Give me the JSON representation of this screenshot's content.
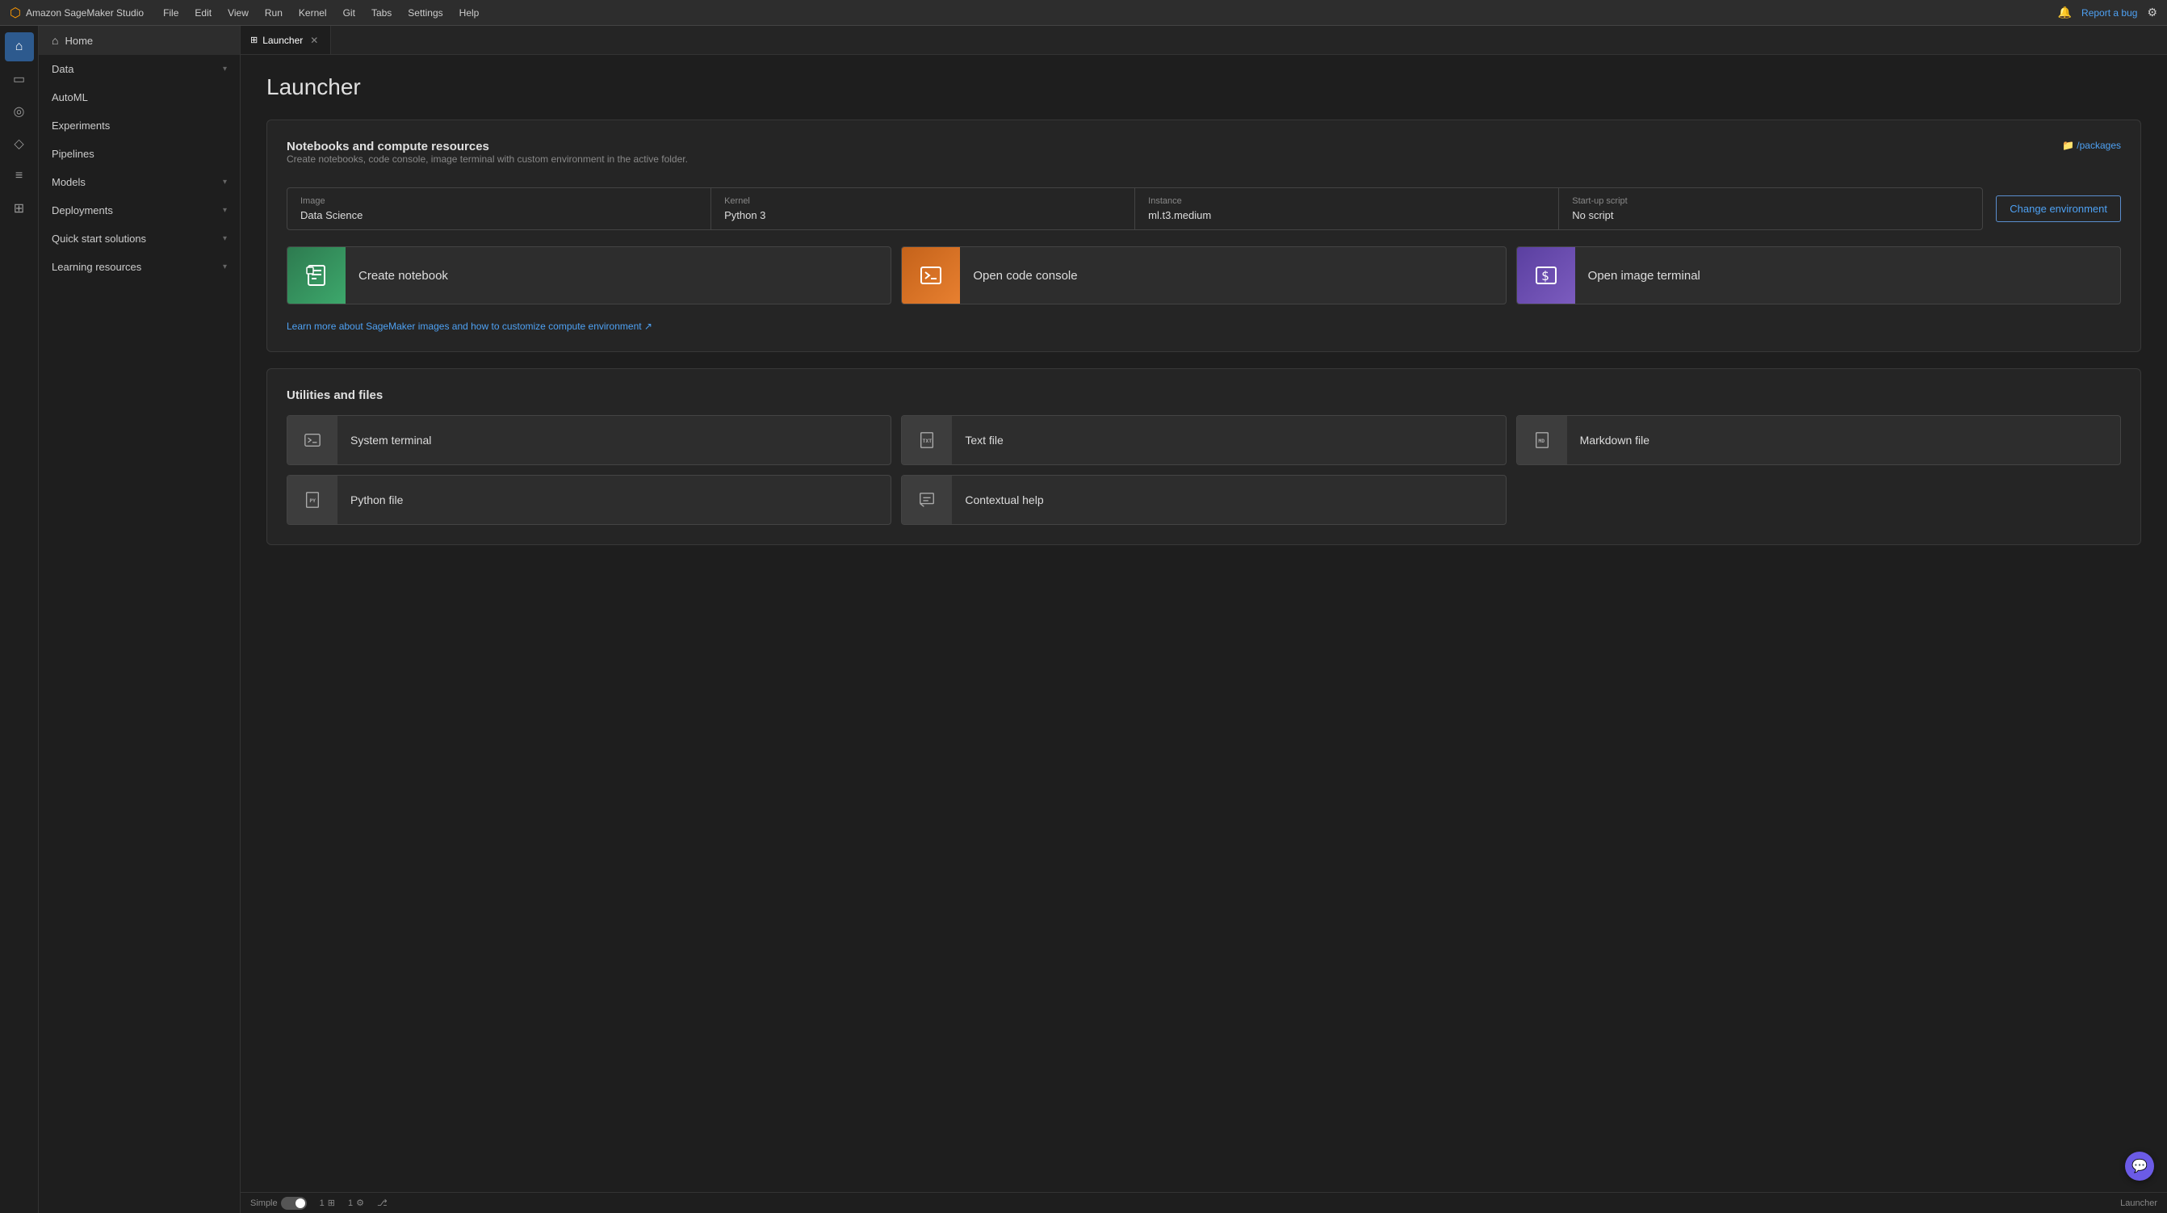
{
  "app": {
    "name": "Amazon SageMaker Studio",
    "logo_unicode": "⬡"
  },
  "menubar": {
    "items": [
      "File",
      "Edit",
      "View",
      "Run",
      "Kernel",
      "Git",
      "Tabs",
      "Settings",
      "Help"
    ],
    "notification_icon": "🔔",
    "report_bug": "Report a bug",
    "settings_icon": "⚙"
  },
  "icon_sidebar": {
    "items": [
      {
        "icon": "⌂",
        "name": "home-icon",
        "active": true
      },
      {
        "icon": "▭",
        "name": "files-icon",
        "active": false
      },
      {
        "icon": "◎",
        "name": "circle-icon",
        "active": false
      },
      {
        "icon": "⬡",
        "name": "hex-icon",
        "active": false
      },
      {
        "icon": "≡",
        "name": "list-icon",
        "active": false
      },
      {
        "icon": "⊞",
        "name": "grid-icon",
        "active": false
      }
    ]
  },
  "nav_sidebar": {
    "items": [
      {
        "label": "Home",
        "icon": "⌂",
        "has_chevron": false
      },
      {
        "label": "Data",
        "icon": "",
        "has_chevron": true
      },
      {
        "label": "AutoML",
        "icon": "",
        "has_chevron": false
      },
      {
        "label": "Experiments",
        "icon": "",
        "has_chevron": false
      },
      {
        "label": "Pipelines",
        "icon": "",
        "has_chevron": false
      },
      {
        "label": "Models",
        "icon": "",
        "has_chevron": true
      },
      {
        "label": "Deployments",
        "icon": "",
        "has_chevron": true
      },
      {
        "label": "Quick start solutions",
        "icon": "",
        "has_chevron": true
      },
      {
        "label": "Learning resources",
        "icon": "",
        "has_chevron": true
      }
    ]
  },
  "tabs": [
    {
      "label": "Launcher",
      "icon": "⊞",
      "active": true,
      "closeable": true
    }
  ],
  "launcher": {
    "title": "Launcher",
    "notebooks_section": {
      "title": "Notebooks and compute resources",
      "subtitle": "Create notebooks, code console, image terminal with custom environment in the active folder.",
      "packages_link": "📁 /packages",
      "environment": {
        "image_label": "Image",
        "image_value": "Data Science",
        "kernel_label": "Kernel",
        "kernel_value": "Python 3",
        "instance_label": "Instance",
        "instance_value": "ml.t3.medium",
        "startup_label": "Start-up script",
        "startup_value": "No script",
        "change_btn": "Change environment"
      },
      "action_buttons": [
        {
          "label": "Create notebook",
          "icon": "⊡",
          "style": "green"
        },
        {
          "label": "Open code console",
          "icon": ">_",
          "style": "orange"
        },
        {
          "label": "Open image terminal",
          "icon": "$",
          "style": "purple"
        }
      ],
      "learn_link": "Learn more about SageMaker images and how to customize compute environment ↗"
    },
    "utilities_section": {
      "title": "Utilities and files",
      "buttons_row1": [
        {
          "label": "System terminal",
          "icon": "⊡"
        },
        {
          "label": "Text file",
          "icon": "TXT"
        },
        {
          "label": "Markdown file",
          "icon": "MD"
        }
      ],
      "buttons_row2": [
        {
          "label": "Python file",
          "icon": "PY"
        },
        {
          "label": "Contextual help",
          "icon": "⊡"
        }
      ]
    }
  },
  "status_bar": {
    "mode_label": "Simple",
    "number1": "1",
    "icon1": "⊞",
    "number2": "1",
    "icon2": "⚙",
    "git_icon": "⎇",
    "launcher_label": "Launcher"
  }
}
